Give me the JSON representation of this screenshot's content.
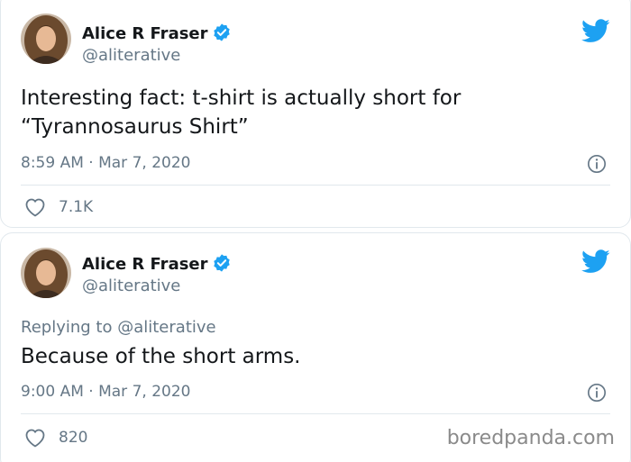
{
  "tweets": [
    {
      "display_name": "Alice R Fraser",
      "handle": "@aliterative",
      "text_lines": [
        "Interesting fact: t-shirt is actually short for",
        "“Tyrannosaurus Shirt”"
      ],
      "timestamp": "8:59 AM · Mar 7, 2020",
      "likes": "7.1K",
      "verified": true,
      "icons": [
        "avatar",
        "verified-badge-icon",
        "twitter-bird-icon",
        "info-icon",
        "heart-icon"
      ]
    },
    {
      "display_name": "Alice R Fraser",
      "handle": "@aliterative",
      "reply_prefix": "Replying to",
      "reply_mention": "@aliterative",
      "text_lines": [
        "Because of the short arms."
      ],
      "timestamp": "9:00 AM · Mar 7, 2020",
      "likes": "820",
      "verified": true,
      "icons": [
        "avatar",
        "verified-badge-icon",
        "twitter-bird-icon",
        "info-icon",
        "heart-icon"
      ]
    }
  ],
  "watermark": "boredpanda.com",
  "colors": {
    "twitter_blue": "#1da1f2",
    "text": "#14171a",
    "secondary_text": "#657786",
    "border": "#e1e8ed"
  }
}
